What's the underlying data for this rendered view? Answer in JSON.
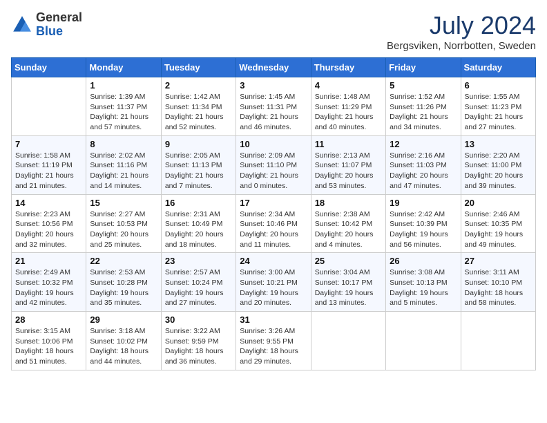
{
  "header": {
    "logo_general": "General",
    "logo_blue": "Blue",
    "month_year": "July 2024",
    "location": "Bergsviken, Norrbotten, Sweden"
  },
  "weekdays": [
    "Sunday",
    "Monday",
    "Tuesday",
    "Wednesday",
    "Thursday",
    "Friday",
    "Saturday"
  ],
  "weeks": [
    [
      {
        "day": "",
        "info": ""
      },
      {
        "day": "1",
        "info": "Sunrise: 1:39 AM\nSunset: 11:37 PM\nDaylight: 21 hours and 57 minutes."
      },
      {
        "day": "2",
        "info": "Sunrise: 1:42 AM\nSunset: 11:34 PM\nDaylight: 21 hours and 52 minutes."
      },
      {
        "day": "3",
        "info": "Sunrise: 1:45 AM\nSunset: 11:31 PM\nDaylight: 21 hours and 46 minutes."
      },
      {
        "day": "4",
        "info": "Sunrise: 1:48 AM\nSunset: 11:29 PM\nDaylight: 21 hours and 40 minutes."
      },
      {
        "day": "5",
        "info": "Sunrise: 1:52 AM\nSunset: 11:26 PM\nDaylight: 21 hours and 34 minutes."
      },
      {
        "day": "6",
        "info": "Sunrise: 1:55 AM\nSunset: 11:23 PM\nDaylight: 21 hours and 27 minutes."
      }
    ],
    [
      {
        "day": "7",
        "info": "Sunrise: 1:58 AM\nSunset: 11:19 PM\nDaylight: 21 hours and 21 minutes."
      },
      {
        "day": "8",
        "info": "Sunrise: 2:02 AM\nSunset: 11:16 PM\nDaylight: 21 hours and 14 minutes."
      },
      {
        "day": "9",
        "info": "Sunrise: 2:05 AM\nSunset: 11:13 PM\nDaylight: 21 hours and 7 minutes."
      },
      {
        "day": "10",
        "info": "Sunrise: 2:09 AM\nSunset: 11:10 PM\nDaylight: 21 hours and 0 minutes."
      },
      {
        "day": "11",
        "info": "Sunrise: 2:13 AM\nSunset: 11:07 PM\nDaylight: 20 hours and 53 minutes."
      },
      {
        "day": "12",
        "info": "Sunrise: 2:16 AM\nSunset: 11:03 PM\nDaylight: 20 hours and 47 minutes."
      },
      {
        "day": "13",
        "info": "Sunrise: 2:20 AM\nSunset: 11:00 PM\nDaylight: 20 hours and 39 minutes."
      }
    ],
    [
      {
        "day": "14",
        "info": "Sunrise: 2:23 AM\nSunset: 10:56 PM\nDaylight: 20 hours and 32 minutes."
      },
      {
        "day": "15",
        "info": "Sunrise: 2:27 AM\nSunset: 10:53 PM\nDaylight: 20 hours and 25 minutes."
      },
      {
        "day": "16",
        "info": "Sunrise: 2:31 AM\nSunset: 10:49 PM\nDaylight: 20 hours and 18 minutes."
      },
      {
        "day": "17",
        "info": "Sunrise: 2:34 AM\nSunset: 10:46 PM\nDaylight: 20 hours and 11 minutes."
      },
      {
        "day": "18",
        "info": "Sunrise: 2:38 AM\nSunset: 10:42 PM\nDaylight: 20 hours and 4 minutes."
      },
      {
        "day": "19",
        "info": "Sunrise: 2:42 AM\nSunset: 10:39 PM\nDaylight: 19 hours and 56 minutes."
      },
      {
        "day": "20",
        "info": "Sunrise: 2:46 AM\nSunset: 10:35 PM\nDaylight: 19 hours and 49 minutes."
      }
    ],
    [
      {
        "day": "21",
        "info": "Sunrise: 2:49 AM\nSunset: 10:32 PM\nDaylight: 19 hours and 42 minutes."
      },
      {
        "day": "22",
        "info": "Sunrise: 2:53 AM\nSunset: 10:28 PM\nDaylight: 19 hours and 35 minutes."
      },
      {
        "day": "23",
        "info": "Sunrise: 2:57 AM\nSunset: 10:24 PM\nDaylight: 19 hours and 27 minutes."
      },
      {
        "day": "24",
        "info": "Sunrise: 3:00 AM\nSunset: 10:21 PM\nDaylight: 19 hours and 20 minutes."
      },
      {
        "day": "25",
        "info": "Sunrise: 3:04 AM\nSunset: 10:17 PM\nDaylight: 19 hours and 13 minutes."
      },
      {
        "day": "26",
        "info": "Sunrise: 3:08 AM\nSunset: 10:13 PM\nDaylight: 19 hours and 5 minutes."
      },
      {
        "day": "27",
        "info": "Sunrise: 3:11 AM\nSunset: 10:10 PM\nDaylight: 18 hours and 58 minutes."
      }
    ],
    [
      {
        "day": "28",
        "info": "Sunrise: 3:15 AM\nSunset: 10:06 PM\nDaylight: 18 hours and 51 minutes."
      },
      {
        "day": "29",
        "info": "Sunrise: 3:18 AM\nSunset: 10:02 PM\nDaylight: 18 hours and 44 minutes."
      },
      {
        "day": "30",
        "info": "Sunrise: 3:22 AM\nSunset: 9:59 PM\nDaylight: 18 hours and 36 minutes."
      },
      {
        "day": "31",
        "info": "Sunrise: 3:26 AM\nSunset: 9:55 PM\nDaylight: 18 hours and 29 minutes."
      },
      {
        "day": "",
        "info": ""
      },
      {
        "day": "",
        "info": ""
      },
      {
        "day": "",
        "info": ""
      }
    ]
  ]
}
